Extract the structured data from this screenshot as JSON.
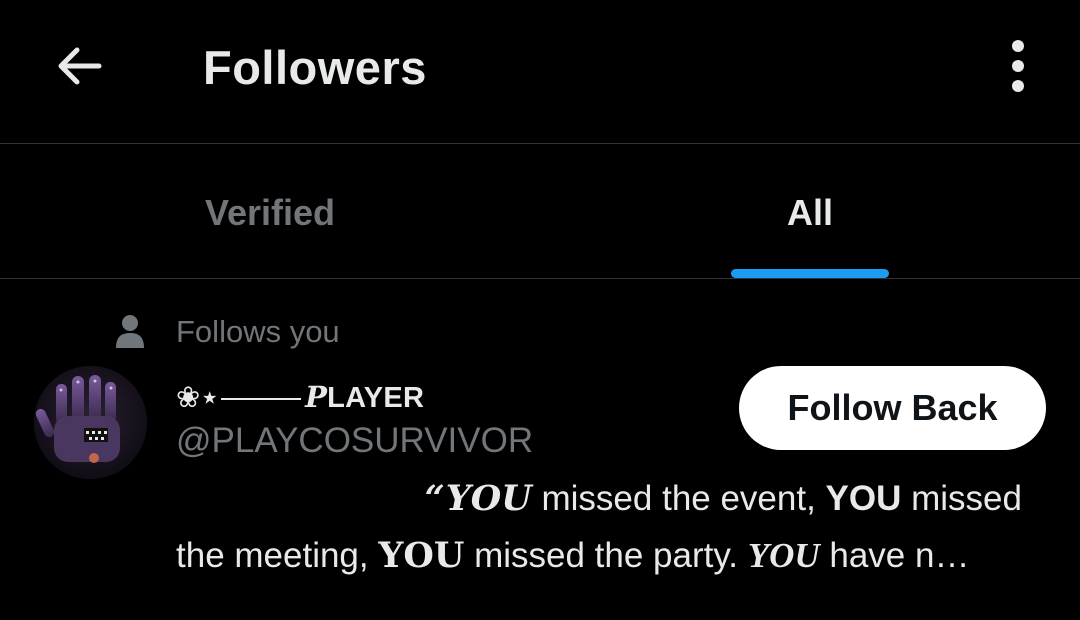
{
  "header": {
    "title": "Followers",
    "back_icon": "arrow-left-icon",
    "more_icon": "more-vertical-icon"
  },
  "tabs": [
    {
      "label": "Verified",
      "active": false
    },
    {
      "label": "All",
      "active": true
    }
  ],
  "colors": {
    "accent": "#1d9bf0",
    "background": "#000000",
    "text_primary": "#e7e9ea",
    "text_secondary": "#71767b",
    "divider": "#2f3336",
    "button_bg": "#ffffff",
    "button_text": "#0f1419"
  },
  "follower": {
    "follows_you_label": "Follows you",
    "follows_you_icon": "person-icon",
    "name_prefix": "❀⋆",
    "name_text": "PLAYER",
    "name_first_letter": "P",
    "name_rest": "LAYER",
    "handle": "@PLAYCOSURVIVOR",
    "follow_button_label": "Follow Back",
    "bio": {
      "open_quote": "“",
      "you1": "YOU",
      "part1": " missed the event, ",
      "you2": "YOU",
      "part2": " missed",
      "part3": "the meeting, ",
      "you3": "YOU",
      "part4": " missed the party. ",
      "you4": "YOU",
      "part5": " have n…"
    }
  }
}
